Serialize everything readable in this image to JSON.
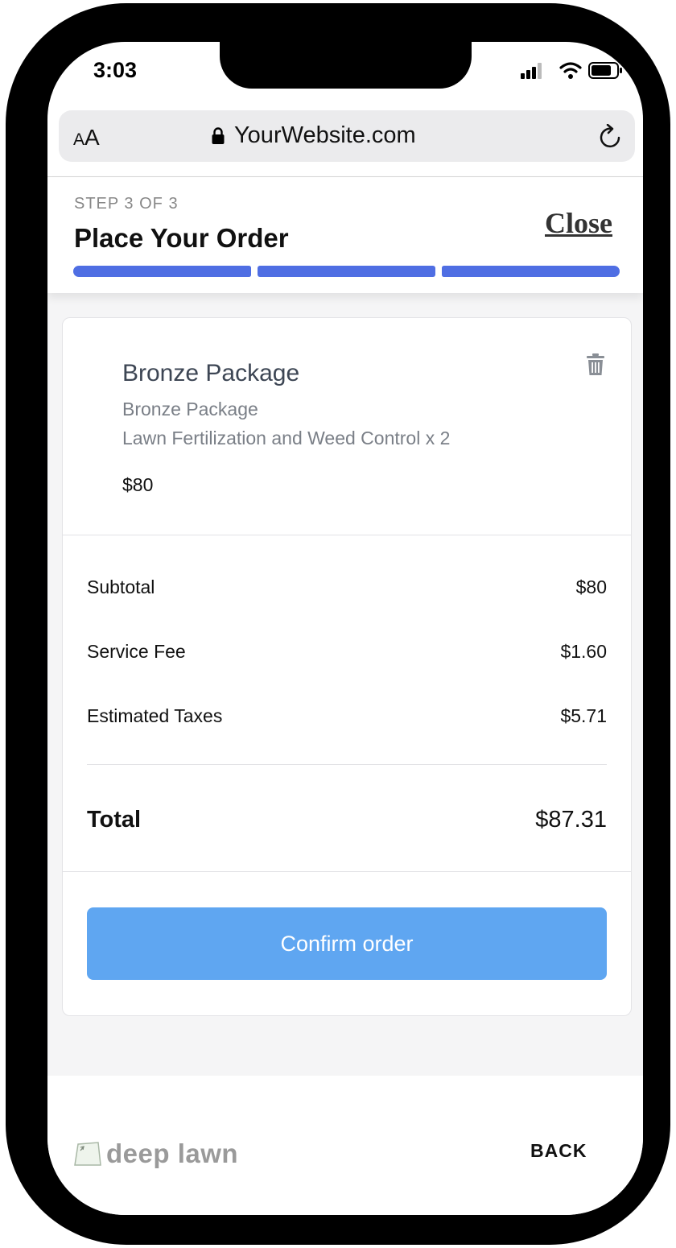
{
  "status_bar": {
    "time": "3:03"
  },
  "browser": {
    "text_size_label_small": "A",
    "text_size_label_large": "A",
    "url": "YourWebsite.com"
  },
  "header": {
    "step_label": "STEP 3 OF 3",
    "title": "Place Your Order",
    "close_label": "Close",
    "progress": {
      "completed_steps": 3,
      "total_steps": 3
    },
    "progress_color": "#4f6ee3"
  },
  "order_item": {
    "name": "Bronze Package",
    "subtitle": "Bronze Package",
    "description": "Lawn Fertilization and Weed Control x 2",
    "price": "$80"
  },
  "summary": {
    "rows": [
      {
        "label": "Subtotal",
        "amount": "$80"
      },
      {
        "label": "Service Fee",
        "amount": "$1.60"
      },
      {
        "label": "Estimated Taxes",
        "amount": "$5.71"
      }
    ],
    "total": {
      "label": "Total",
      "amount": "$87.31"
    }
  },
  "confirm_button": {
    "label": "Confirm order",
    "color": "#5fa6f1"
  },
  "footer": {
    "logo_text": "deep lawn",
    "back_label": "BACK"
  },
  "icons": [
    "signal-icon",
    "wifi-icon",
    "battery-icon",
    "lock-icon",
    "reload-icon",
    "trash-icon",
    "deep-lawn-logo-icon"
  ]
}
